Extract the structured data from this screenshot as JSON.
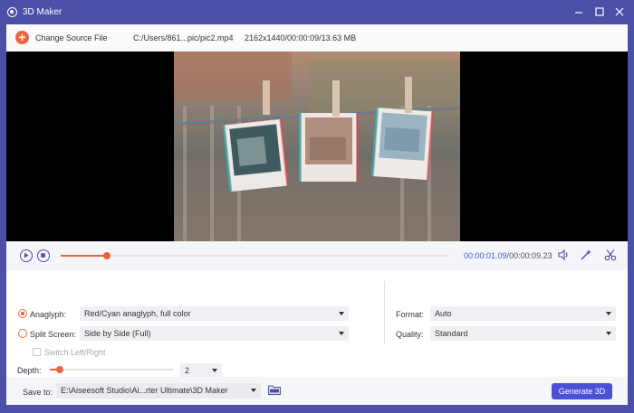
{
  "titlebar": {
    "title": "3D Maker",
    "minimize_icon": "minimize-icon",
    "maximize_icon": "maximize-icon",
    "close_icon": "close-icon"
  },
  "source": {
    "change_label": "Change Source File",
    "path": "C:/Users/861...pic/pic2.mp4",
    "info": "2162x1440/00:00:09/13.63 MB"
  },
  "player": {
    "current_time": "00:00:01.09",
    "separator": "/",
    "total_time": "00:00:09.23",
    "progress": 0.1181
  },
  "settings": {
    "anaglyph_label": "Anaglyph:",
    "anaglyph_value": "Red/Cyan anaglyph, full color",
    "anaglyph_selected": true,
    "split_label": "Split Screen:",
    "split_value": "Side by Side (Full)",
    "split_selected": false,
    "switch_label": "Switch Left/Right",
    "depth_label": "Depth:",
    "depth_value": "2",
    "format_label": "Format:",
    "format_value": "Auto",
    "quality_label": "Quality:",
    "quality_value": "Standard"
  },
  "footer": {
    "save_label": "Save to:",
    "save_path": "E:\\Aiseesoft Studio\\Ai...rter Ultimate\\3D Maker",
    "generate_label": "Generate 3D"
  },
  "colors": {
    "frame": "#4b4fa6",
    "accent": "#f0623c",
    "primary_button": "#4b50d6",
    "time_current": "#3b5bdb"
  }
}
